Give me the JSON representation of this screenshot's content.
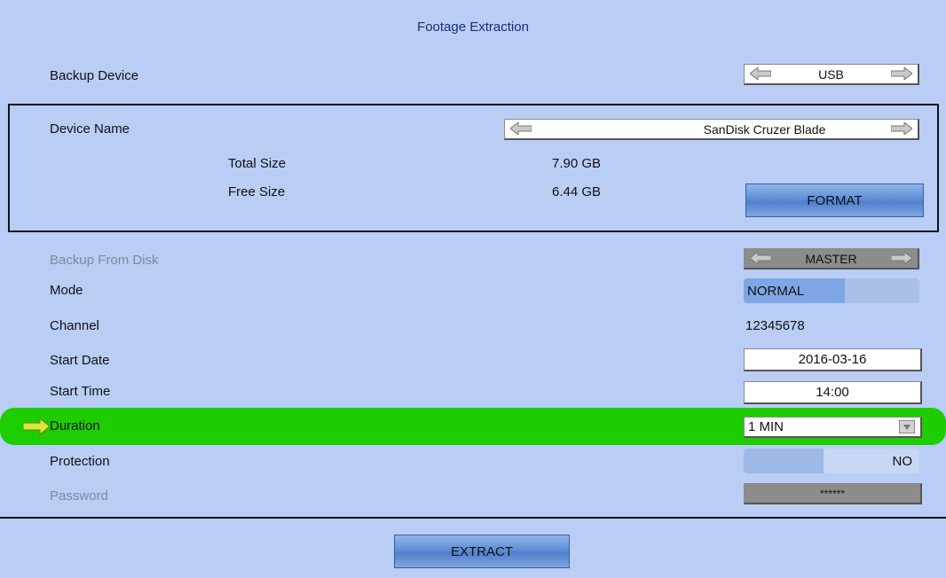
{
  "title": "Footage Extraction",
  "backup_device": {
    "label": "Backup Device",
    "value": "USB"
  },
  "device": {
    "name_label": "Device Name",
    "name_value": "SanDisk Cruzer Blade",
    "total_label": "Total Size",
    "total_value": "7.90 GB",
    "free_label": "Free Size",
    "free_value": "6.44 GB",
    "format_label": "FORMAT"
  },
  "backup_from_disk": {
    "label": "Backup From Disk",
    "value": "MASTER"
  },
  "mode": {
    "label": "Mode",
    "value": "NORMAL"
  },
  "channel": {
    "label": "Channel",
    "value": "12345678"
  },
  "start_date": {
    "label": "Start Date",
    "value": "2016-03-16"
  },
  "start_time": {
    "label": "Start Time",
    "value": "14:00"
  },
  "duration": {
    "label": "Duration",
    "value": "1 MIN"
  },
  "protection": {
    "label": "Protection",
    "value": "NO"
  },
  "password": {
    "label": "Password",
    "value": "******"
  },
  "extract_label": "EXTRACT",
  "colors": {
    "background": "#b9cdf5",
    "highlight": "#1dcd00",
    "button": "#5f8fd6"
  }
}
